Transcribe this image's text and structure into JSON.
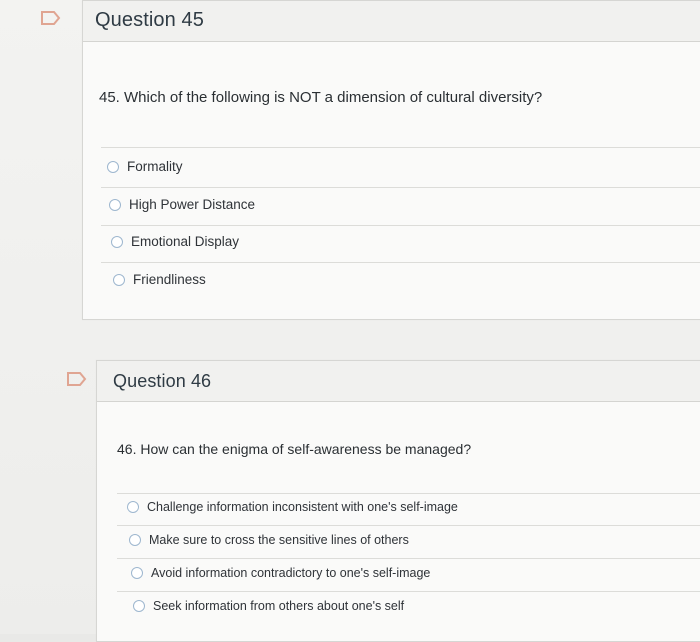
{
  "questions": [
    {
      "title": "Question 45",
      "text": "45. Which of the following is NOT a dimension of cultural diversity?",
      "answers": [
        {
          "label": "Formality",
          "selected": false
        },
        {
          "label": "High Power Distance",
          "selected": false
        },
        {
          "label": "Emotional Display",
          "selected": false
        },
        {
          "label": "Friendliness",
          "selected": false
        }
      ]
    },
    {
      "title": "Question 46",
      "text": "46. How can the enigma of self-awareness be managed?",
      "answers": [
        {
          "label": "Challenge information inconsistent with one's self-image",
          "selected": false
        },
        {
          "label": "Make sure to cross the sensitive lines of others",
          "selected": false
        },
        {
          "label": "Avoid information contradictory to one's self-image",
          "selected": false
        },
        {
          "label": "Seek information from others about one's self",
          "selected": false
        }
      ]
    }
  ],
  "colors": {
    "flag_stroke": "#e0a592",
    "radio_border": "#9eb7cf",
    "text": "#2d3b45"
  },
  "icons": {
    "flag": "bookmark-flag-icon",
    "radio": "radio-button-icon"
  }
}
